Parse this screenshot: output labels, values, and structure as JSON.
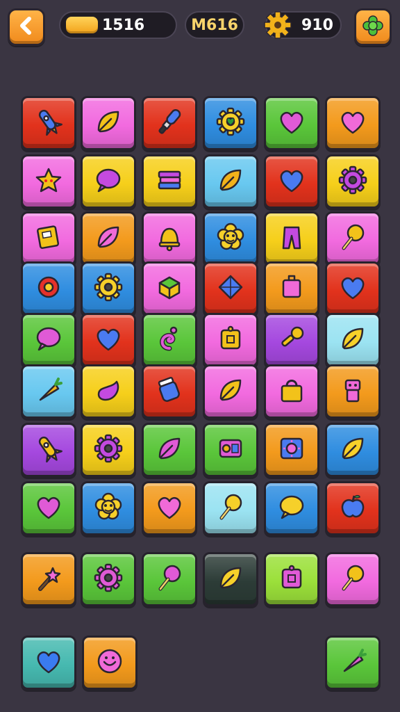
{
  "hud": {
    "back_icon": "chevron-left-icon",
    "coins_value": "1516",
    "moves_label": "M616",
    "gears_value": "910",
    "gear_icon": "gear-icon",
    "menu_icon": "flower-icon"
  },
  "colors": {
    "red": "#e2321c",
    "pink": "#f26adf",
    "blue": "#2f8de0",
    "green": "#5ac63a",
    "orange": "#f39a1c",
    "yellow": "#f6cf1a",
    "purple": "#a548df",
    "sky": "#68c8f0",
    "cyan": "#9be3f2",
    "lime": "#9be03a",
    "dark": "#2c3c37",
    "teal": "#46b9b0",
    "background": "#3a3542"
  },
  "grid": [
    [
      {
        "c": "red",
        "i": "rocket"
      },
      {
        "c": "pink",
        "i": "leaf"
      },
      {
        "c": "red",
        "i": "brush"
      },
      {
        "c": "blue",
        "i": "gear-heart"
      },
      {
        "c": "green",
        "i": "heart"
      },
      {
        "c": "orange",
        "i": "heart"
      }
    ],
    [
      {
        "c": "pink",
        "i": "star"
      },
      {
        "c": "yellow",
        "i": "chat"
      },
      {
        "c": "yellow",
        "i": "books"
      },
      {
        "c": "sky",
        "i": "leaf"
      },
      {
        "c": "red",
        "i": "heart"
      },
      {
        "c": "yellow",
        "i": "gear"
      }
    ],
    [
      {
        "c": "pink",
        "i": "book"
      },
      {
        "c": "orange",
        "i": "leaf"
      },
      {
        "c": "pink",
        "i": "bell"
      },
      {
        "c": "blue",
        "i": "flower"
      },
      {
        "c": "yellow",
        "i": "pants"
      },
      {
        "c": "pink",
        "i": "lollipop"
      }
    ],
    [
      {
        "c": "blue",
        "i": "ring"
      },
      {
        "c": "blue",
        "i": "gear"
      },
      {
        "c": "pink",
        "i": "cube"
      },
      {
        "c": "red",
        "i": "gem"
      },
      {
        "c": "orange",
        "i": "box"
      },
      {
        "c": "red",
        "i": "heart"
      }
    ],
    [
      {
        "c": "green",
        "i": "chat"
      },
      {
        "c": "red",
        "i": "heart"
      },
      {
        "c": "green",
        "i": "swirl"
      },
      {
        "c": "pink",
        "i": "square"
      },
      {
        "c": "purple",
        "i": "key"
      },
      {
        "c": "cyan",
        "i": "leaf"
      }
    ],
    [
      {
        "c": "sky",
        "i": "carrot"
      },
      {
        "c": "yellow",
        "i": "bean"
      },
      {
        "c": "red",
        "i": "jar"
      },
      {
        "c": "pink",
        "i": "leaf"
      },
      {
        "c": "pink",
        "i": "bag"
      },
      {
        "c": "orange",
        "i": "robot"
      }
    ],
    [
      {
        "c": "purple",
        "i": "rocket"
      },
      {
        "c": "yellow",
        "i": "gear"
      },
      {
        "c": "green",
        "i": "leaf"
      },
      {
        "c": "green",
        "i": "radio"
      },
      {
        "c": "orange",
        "i": "sun"
      },
      {
        "c": "blue",
        "i": "leaf"
      }
    ],
    [
      {
        "c": "green",
        "i": "heart"
      },
      {
        "c": "blue",
        "i": "flower"
      },
      {
        "c": "orange",
        "i": "heart"
      },
      {
        "c": "cyan",
        "i": "lollipop"
      },
      {
        "c": "blue",
        "i": "chat"
      },
      {
        "c": "red",
        "i": "apple"
      }
    ],
    [
      {
        "c": "orange",
        "i": "wand"
      },
      {
        "c": "green",
        "i": "gear"
      },
      {
        "c": "green",
        "i": "lollipop"
      },
      {
        "c": "dark",
        "i": "leaf"
      },
      {
        "c": "lime",
        "i": "square"
      },
      {
        "c": "pink",
        "i": "lollipop"
      }
    ]
  ],
  "tray": [
    {
      "c": "teal",
      "i": "heart"
    },
    {
      "c": "orange",
      "i": "smile"
    },
    {
      "c": "green",
      "i": "carrot"
    }
  ]
}
